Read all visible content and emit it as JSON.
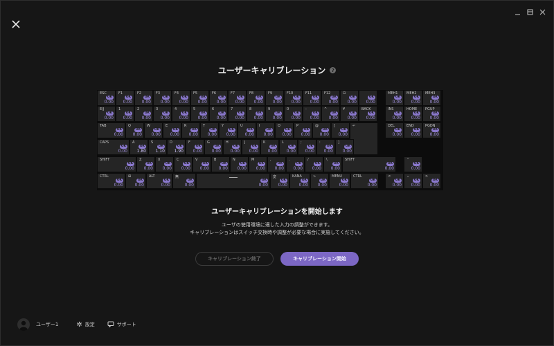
{
  "title": "ユーザーキャリブレーション",
  "heading": "ユーザーキャリブレーションを開始します",
  "desc_line1": "ユーザの使用環境に適した入力の調整ができます。",
  "desc_line2": "キャリブレーションはスイッチ交換時や調整が必要な場合に実施してください。",
  "btn_end": "キャリブレーション終了",
  "btn_start": "キャリブレーション開始",
  "user": "ユーザー1",
  "settings": "設定",
  "support": "サポート",
  "badge": "OK",
  "colors": {
    "accent": "#7c67c4",
    "badge": "#8a78cd",
    "value": "#a494e3"
  },
  "keyboard": {
    "rows": [
      [
        {
          "l": "ESC",
          "v": "0.00"
        },
        {
          "l": "F1",
          "v": "0.00"
        },
        {
          "l": "F2",
          "v": "0.00"
        },
        {
          "l": "F3",
          "v": "0.00"
        },
        {
          "l": "F4",
          "v": "0.00"
        },
        {
          "l": "F5",
          "v": "0.00"
        },
        {
          "l": "F6",
          "v": "0.00"
        },
        {
          "l": "F7",
          "v": "0.00"
        },
        {
          "l": "F8",
          "v": "0.00"
        },
        {
          "l": "F9",
          "v": "0.00"
        },
        {
          "l": "F10",
          "v": "0.00"
        },
        {
          "l": "F11",
          "v": "0.00"
        },
        {
          "l": "F12",
          "v": "0.00"
        },
        {
          "l": "⊡",
          "v": "0.00"
        },
        {
          "l": "",
          "v": "0.00"
        },
        {
          "l": "MEH1",
          "v": "0.00"
        },
        {
          "l": "MEH2",
          "v": "0.00"
        },
        {
          "l": "MEH3",
          "v": "0.00"
        }
      ],
      [
        {
          "l": "E/J",
          "v": "0.00"
        },
        {
          "l": "1",
          "v": "0.00"
        },
        {
          "l": "2",
          "v": "0.00"
        },
        {
          "l": "3",
          "v": "0.00"
        },
        {
          "l": "4",
          "v": "0.00"
        },
        {
          "l": "5",
          "v": "0.00"
        },
        {
          "l": "6",
          "v": "0.00"
        },
        {
          "l": "7",
          "v": "0.00"
        },
        {
          "l": "8",
          "v": "0.00"
        },
        {
          "l": "9",
          "v": "0.00"
        },
        {
          "l": "0",
          "v": "0.00"
        },
        {
          "l": "-",
          "v": "0.00"
        },
        {
          "l": "^",
          "v": "0.00"
        },
        {
          "l": "¥",
          "v": "0.00"
        },
        {
          "l": "BACK",
          "v": "0.00"
        },
        {
          "l": "INS",
          "v": "0.00"
        },
        {
          "l": "HOME",
          "v": "0.00"
        },
        {
          "l": "PGUP",
          "v": "0.00"
        }
      ],
      [
        {
          "l": "TAB",
          "v": "0.00"
        },
        {
          "l": "Q",
          "v": "0.00"
        },
        {
          "l": "W",
          "v": "0.00"
        },
        {
          "l": "E",
          "v": "0.00"
        },
        {
          "l": "R",
          "v": "0.00"
        },
        {
          "l": "T",
          "v": "0.00"
        },
        {
          "l": "Y",
          "v": "0.00"
        },
        {
          "l": "U",
          "v": "0.00"
        },
        {
          "l": "I",
          "v": "0.00"
        },
        {
          "l": "O",
          "v": "0.00"
        },
        {
          "l": "P",
          "v": "0.00"
        },
        {
          "l": "@",
          "v": "0.00"
        },
        {
          "l": "[",
          "v": "0.00"
        },
        {
          "l": "↵",
          "v": ""
        },
        {
          "l": "DEL",
          "v": "0.00"
        },
        {
          "l": "END",
          "v": "0.00"
        },
        {
          "l": "PGDN",
          "v": "0.00"
        }
      ],
      [
        {
          "l": "CAPS",
          "v": "0.00"
        },
        {
          "l": "A",
          "v": "1.80"
        },
        {
          "l": "S",
          "v": "1.10"
        },
        {
          "l": "D",
          "v": "1.90"
        },
        {
          "l": "F",
          "v": "0.00"
        },
        {
          "l": "G",
          "v": "0.00"
        },
        {
          "l": "H",
          "v": "0.00"
        },
        {
          "l": "J",
          "v": "0.00"
        },
        {
          "l": "K",
          "v": "0.00"
        },
        {
          "l": "L",
          "v": "0.00"
        },
        {
          "l": ";",
          "v": "0.00"
        },
        {
          "l": ":",
          "v": "0.00"
        },
        {
          "l": "]",
          "v": "0.00"
        }
      ],
      [
        {
          "l": "SHIFT",
          "v": "0.00"
        },
        {
          "l": "Z",
          "v": "0.00"
        },
        {
          "l": "X",
          "v": "0.00"
        },
        {
          "l": "C",
          "v": "0.00"
        },
        {
          "l": "V",
          "v": "0.00"
        },
        {
          "l": "B",
          "v": "0.00"
        },
        {
          "l": "N",
          "v": "0.00"
        },
        {
          "l": "M",
          "v": "0.00"
        },
        {
          "l": ",",
          "v": "0.00"
        },
        {
          "l": ".",
          "v": "0.00"
        },
        {
          "l": "/",
          "v": "0.00"
        },
        {
          "l": "\\",
          "v": "0.00"
        },
        {
          "l": "SHIFT",
          "v": "0.00"
        },
        {
          "l": "⌃",
          "v": "0.00"
        }
      ],
      [
        {
          "l": "CTRL",
          "v": "0.00"
        },
        {
          "l": "⊞",
          "v": "0.00"
        },
        {
          "l": "ALT",
          "v": "0.00"
        },
        {
          "l": "無",
          "v": "0.00"
        },
        {
          "l": "",
          "v": "0.00"
        },
        {
          "l": "変",
          "v": "0.00"
        },
        {
          "l": "KANA",
          "v": "0.00"
        },
        {
          "l": "∿",
          "v": "0.00"
        },
        {
          "l": "MENU",
          "v": "0.00"
        },
        {
          "l": "CTRL",
          "v": "0.00"
        },
        {
          "l": "<",
          "v": "0.00"
        },
        {
          "l": "⌄",
          "v": "0.00"
        },
        {
          "l": ">",
          "v": "0.00"
        }
      ]
    ]
  }
}
